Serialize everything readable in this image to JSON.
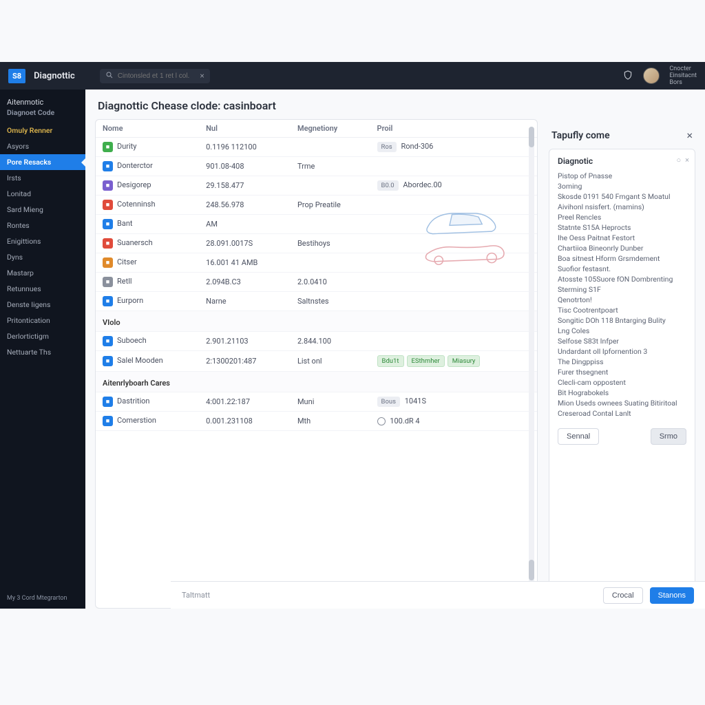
{
  "topbar": {
    "logo": "S8",
    "title": "Diagnottic",
    "search_placeholder": "Cintonsled et 1 ret l col.",
    "user_line1": "Cnocter",
    "user_line2": "Einsitacnt",
    "user_line3": "Bors"
  },
  "sidebar": {
    "header1": "Aitenmotic",
    "header2": "Diagnoet Code",
    "items": [
      {
        "label": "Omuly Renner",
        "cls": "gold"
      },
      {
        "label": "Asyors",
        "cls": ""
      },
      {
        "label": "Pore Resacks",
        "cls": "active"
      },
      {
        "label": "Irsts",
        "cls": ""
      },
      {
        "label": "Lonitad",
        "cls": ""
      },
      {
        "label": "Sard Mieng",
        "cls": ""
      },
      {
        "label": "Rontes",
        "cls": ""
      },
      {
        "label": "Enigittions",
        "cls": ""
      },
      {
        "label": "Dyns",
        "cls": ""
      },
      {
        "label": "Mastarp",
        "cls": ""
      },
      {
        "label": "Retunnues",
        "cls": ""
      },
      {
        "label": "Denste Iigens",
        "cls": ""
      },
      {
        "label": "Pritontication",
        "cls": ""
      },
      {
        "label": "Derlortictigm",
        "cls": ""
      },
      {
        "label": "Nettuarte Ths",
        "cls": ""
      }
    ],
    "footer": "My 3 Cord Mtegrarton"
  },
  "main": {
    "title": "Diagnottic Chease clode: casinboart",
    "columns": {
      "c1": "Nome",
      "c2": "Nul",
      "c3": "Megnetiony",
      "c4": "Proil"
    },
    "section1_rows": [
      {
        "ic": "ic-green",
        "name": "Durity",
        "nul": "0.1196 112100",
        "meg": "",
        "tag": "Ros",
        "proil": "Rond-306"
      },
      {
        "ic": "ic-blue",
        "name": "Donterctor",
        "nul": "901.08-408",
        "meg": "Trme",
        "tag": "",
        "proil": ""
      },
      {
        "ic": "ic-purple",
        "name": "Desigorep",
        "nul": "29.158.477",
        "meg": "",
        "tag": "B0.0",
        "proil": "Abordec.00"
      },
      {
        "ic": "ic-red",
        "name": "Cotenninsh",
        "nul": "248.56.978",
        "meg": "Prop Preatile",
        "tag": "",
        "proil": ""
      },
      {
        "ic": "ic-blue",
        "name": "Bant",
        "nul": "AM",
        "meg": "",
        "tag": "",
        "proil": ""
      },
      {
        "ic": "ic-red",
        "name": "Suanersch",
        "nul": "28.091.0017S",
        "meg": "Bestihoys",
        "tag": "",
        "proil": ""
      },
      {
        "ic": "ic-orange",
        "name": "Citser",
        "nul": "16.001 41 AMB",
        "meg": "",
        "tag": "",
        "proil": ""
      },
      {
        "ic": "ic-gray",
        "name": "Retll",
        "nul": "2.094B.C3",
        "meg": "2.0.0410",
        "tag": "",
        "proil": ""
      },
      {
        "ic": "ic-blue",
        "name": "Eurporn",
        "nul": "Narne",
        "meg": "Saltnstes",
        "tag": "",
        "proil": ""
      }
    ],
    "section2_label": "VIolo",
    "section2_rows": [
      {
        "ic": "ic-blue",
        "name": "Suboech",
        "nul": "2.901.21103",
        "meg": "2.844.100",
        "tag": "",
        "proil": ""
      },
      {
        "ic": "ic-blue",
        "name": "Salel Mooden",
        "nul": "2:1300201:487",
        "meg": "List onl",
        "tag": "",
        "proil": "",
        "pills": [
          "Bdu1t",
          "ESthmher",
          "Miasury"
        ]
      }
    ],
    "section3_label": "Aitenrlyboarh Cares",
    "section3_rows": [
      {
        "ic": "ic-blue",
        "name": "Dastrition",
        "nul": "4:001.22:187",
        "meg": "Muni",
        "tag": "Bous",
        "proil": "1041S"
      },
      {
        "ic": "ic-blue",
        "name": "Comerstion",
        "nul": "0.001.231108",
        "meg": "Mth",
        "tag": "",
        "proil": "100.dR 4",
        "radio": true
      }
    ]
  },
  "sidepanel": {
    "title": "Tapufly come",
    "card_title": "Diagnotic",
    "lines": [
      "Pistop of Pnasse",
      "3oming",
      "Skosde 0191 540 Fmgant S Moatul",
      "Aivihonl nsisfert. (mamins)",
      "Preel Rencles",
      "Statnte S15A Heprocts",
      "Ihe Oess Paitnat Festort",
      "Chartiioa Bineonrly Dunber",
      "Boa sitnest Hform Grsmdement",
      "Suofior festasnt.",
      "Atosste 105Suore fON Dombrenting",
      "Sterming S1F",
      "Qenotrton!",
      "Tisc Cootrentpoart",
      "Songitic DOh 118 Bntarging Bulity",
      "Lng Coles",
      "Selfose S83t Infper",
      "Undardant oll Ipfornention 3",
      "The Dingppiss",
      "Furer thsegnent",
      "Clecli-cam oppostent",
      "Bit Hograbokels",
      "Mion Useds ownees Suating Bitiritoal",
      "Creseroad Contal Lanlt"
    ],
    "btn_secondary": "Sennal",
    "btn_primary": "Srmo"
  },
  "footer": {
    "left": "Taltmatt",
    "cancel": "Crocal",
    "confirm": "Stanons"
  }
}
